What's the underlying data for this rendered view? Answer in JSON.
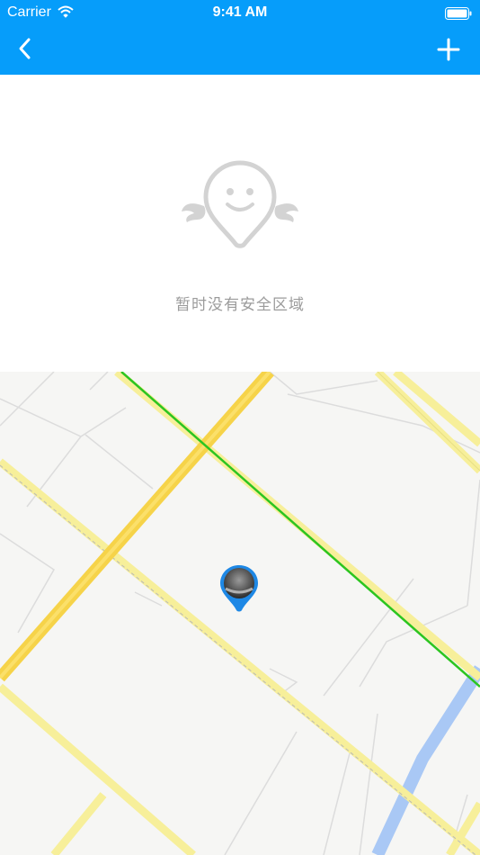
{
  "status_bar": {
    "carrier": "Carrier",
    "time": "9:41 AM"
  },
  "nav_bar": {
    "background_color": "#069dfa",
    "back_icon": "chevron-left-icon",
    "add_icon": "plus-icon"
  },
  "empty_state": {
    "icon": "smiling-location-pin-with-wings-icon",
    "message": "暂时没有安全区域"
  },
  "map": {
    "marker_icon": "avatar-location-pin-icon",
    "road_colors": {
      "main": "#f6d349",
      "secondary": "#f7ef9a",
      "green_line": "#2cc520",
      "river": "#a9c8f5"
    }
  }
}
